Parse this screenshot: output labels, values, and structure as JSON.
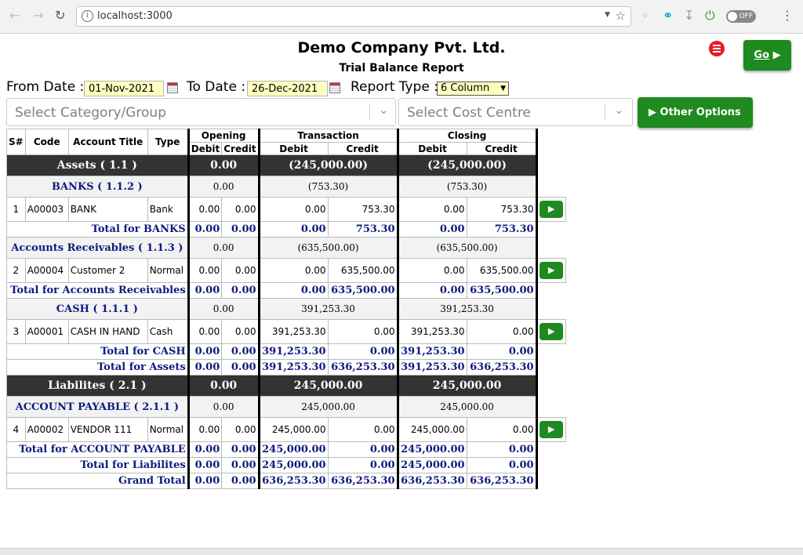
{
  "browser": {
    "url": "localhost:3000",
    "toggle_label": "OFF"
  },
  "header": {
    "company": "Demo Company Pvt. Ltd.",
    "report_title": "Trial Balance Report",
    "go_label": "Go",
    "from_date_label": "From Date :",
    "from_date": "01-Nov-2021",
    "to_date_label": "To Date :",
    "to_date": "26-Dec-2021",
    "report_type_label": "Report Type :",
    "report_type": "6 Column",
    "category_placeholder": "Select Category/Group",
    "cost_centre_placeholder": "Select Cost Centre",
    "other_options_label": "Other Options"
  },
  "table": {
    "headers": {
      "sno": "S#",
      "code": "Code",
      "account_title": "Account Title",
      "type": "Type",
      "opening": "Opening",
      "transaction": "Transaction",
      "closing": "Closing",
      "debit": "Debit",
      "credit": "Credit"
    },
    "rows": [
      {
        "kind": "section",
        "name": "Assets ( 1.1 )",
        "opening": "0.00",
        "transaction": "(245,000.00)",
        "closing": "(245,000.00)"
      },
      {
        "kind": "group",
        "name": "BANKS ( 1.1.2 )",
        "opening": "0.00",
        "transaction": "(753.30)",
        "closing": "(753.30)"
      },
      {
        "kind": "account",
        "sno": "1",
        "code": "A00003",
        "title": "BANK",
        "type": "Bank",
        "od": "0.00",
        "oc": "0.00",
        "td": "0.00",
        "tc": "753.30",
        "cd": "0.00",
        "cc": "753.30"
      },
      {
        "kind": "total",
        "label": "Total for BANKS",
        "od": "0.00",
        "oc": "0.00",
        "td": "0.00",
        "tc": "753.30",
        "cd": "0.00",
        "cc": "753.30"
      },
      {
        "kind": "group",
        "name": "Accounts Receivables ( 1.1.3 )",
        "opening": "0.00",
        "transaction": "(635,500.00)",
        "closing": "(635,500.00)"
      },
      {
        "kind": "account",
        "sno": "2",
        "code": "A00004",
        "title": "Customer 2",
        "type": "Normal",
        "od": "0.00",
        "oc": "0.00",
        "td": "0.00",
        "tc": "635,500.00",
        "cd": "0.00",
        "cc": "635,500.00"
      },
      {
        "kind": "total",
        "label": "Total for Accounts Receivables",
        "od": "0.00",
        "oc": "0.00",
        "td": "0.00",
        "tc": "635,500.00",
        "cd": "0.00",
        "cc": "635,500.00"
      },
      {
        "kind": "group",
        "name": "CASH ( 1.1.1 )",
        "opening": "0.00",
        "transaction": "391,253.30",
        "closing": "391,253.30"
      },
      {
        "kind": "account",
        "sno": "3",
        "code": "A00001",
        "title": "CASH IN HAND",
        "type": "Cash",
        "od": "0.00",
        "oc": "0.00",
        "td": "391,253.30",
        "tc": "0.00",
        "cd": "391,253.30",
        "cc": "0.00"
      },
      {
        "kind": "total",
        "label": "Total for CASH",
        "od": "0.00",
        "oc": "0.00",
        "td": "391,253.30",
        "tc": "0.00",
        "cd": "391,253.30",
        "cc": "0.00"
      },
      {
        "kind": "total",
        "label": "Total for Assets",
        "od": "0.00",
        "oc": "0.00",
        "td": "391,253.30",
        "tc": "636,253.30",
        "cd": "391,253.30",
        "cc": "636,253.30"
      },
      {
        "kind": "section",
        "name": "Liabilites ( 2.1 )",
        "opening": "0.00",
        "transaction": "245,000.00",
        "closing": "245,000.00"
      },
      {
        "kind": "group",
        "name": "ACCOUNT PAYABLE ( 2.1.1 )",
        "opening": "0.00",
        "transaction": "245,000.00",
        "closing": "245,000.00"
      },
      {
        "kind": "account",
        "sno": "4",
        "code": "A00002",
        "title": "VENDOR 111",
        "type": "Normal",
        "od": "0.00",
        "oc": "0.00",
        "td": "245,000.00",
        "tc": "0.00",
        "cd": "245,000.00",
        "cc": "0.00"
      },
      {
        "kind": "total",
        "label": "Total for ACCOUNT PAYABLE",
        "od": "0.00",
        "oc": "0.00",
        "td": "245,000.00",
        "tc": "0.00",
        "cd": "245,000.00",
        "cc": "0.00"
      },
      {
        "kind": "total",
        "label": "Total for Liabilites",
        "od": "0.00",
        "oc": "0.00",
        "td": "245,000.00",
        "tc": "0.00",
        "cd": "245,000.00",
        "cc": "0.00"
      },
      {
        "kind": "total",
        "label": "Grand Total",
        "od": "0.00",
        "oc": "0.00",
        "td": "636,253.30",
        "tc": "636,253.30",
        "cd": "636,253.30",
        "cc": "636,253.30"
      }
    ]
  }
}
